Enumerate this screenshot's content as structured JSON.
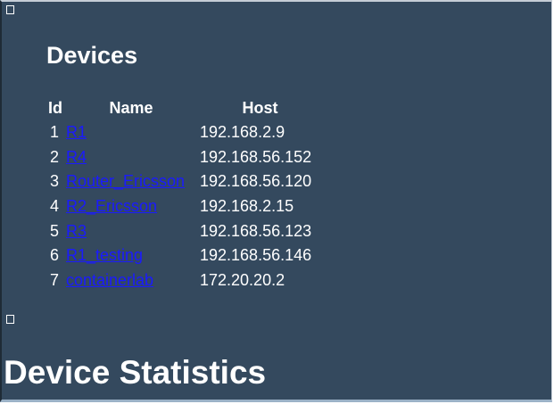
{
  "page": {
    "devices_heading": "Devices",
    "stats_heading": "Device Statistics"
  },
  "table": {
    "headers": {
      "id": "Id",
      "name": "Name",
      "host": "Host"
    },
    "rows": [
      {
        "id": "1",
        "name": "R1",
        "host": "192.168.2.9"
      },
      {
        "id": "2",
        "name": "R4",
        "host": "192.168.56.152"
      },
      {
        "id": "3",
        "name": "Router_Ericsson",
        "host": "192.168.56.120"
      },
      {
        "id": "4",
        "name": "R2_Ericsson",
        "host": "192.168.2.15"
      },
      {
        "id": "5",
        "name": "R3",
        "host": "192.168.56.123"
      },
      {
        "id": "6",
        "name": "R1_testing",
        "host": "192.168.56.146"
      },
      {
        "id": "7",
        "name": "containerlab",
        "host": "172.20.20.2"
      }
    ]
  },
  "colors": {
    "background": "#34495e",
    "text": "#ffffff",
    "link": "#1a1aff"
  },
  "icons": [
    "broken-image-icon",
    "broken-image-icon"
  ]
}
